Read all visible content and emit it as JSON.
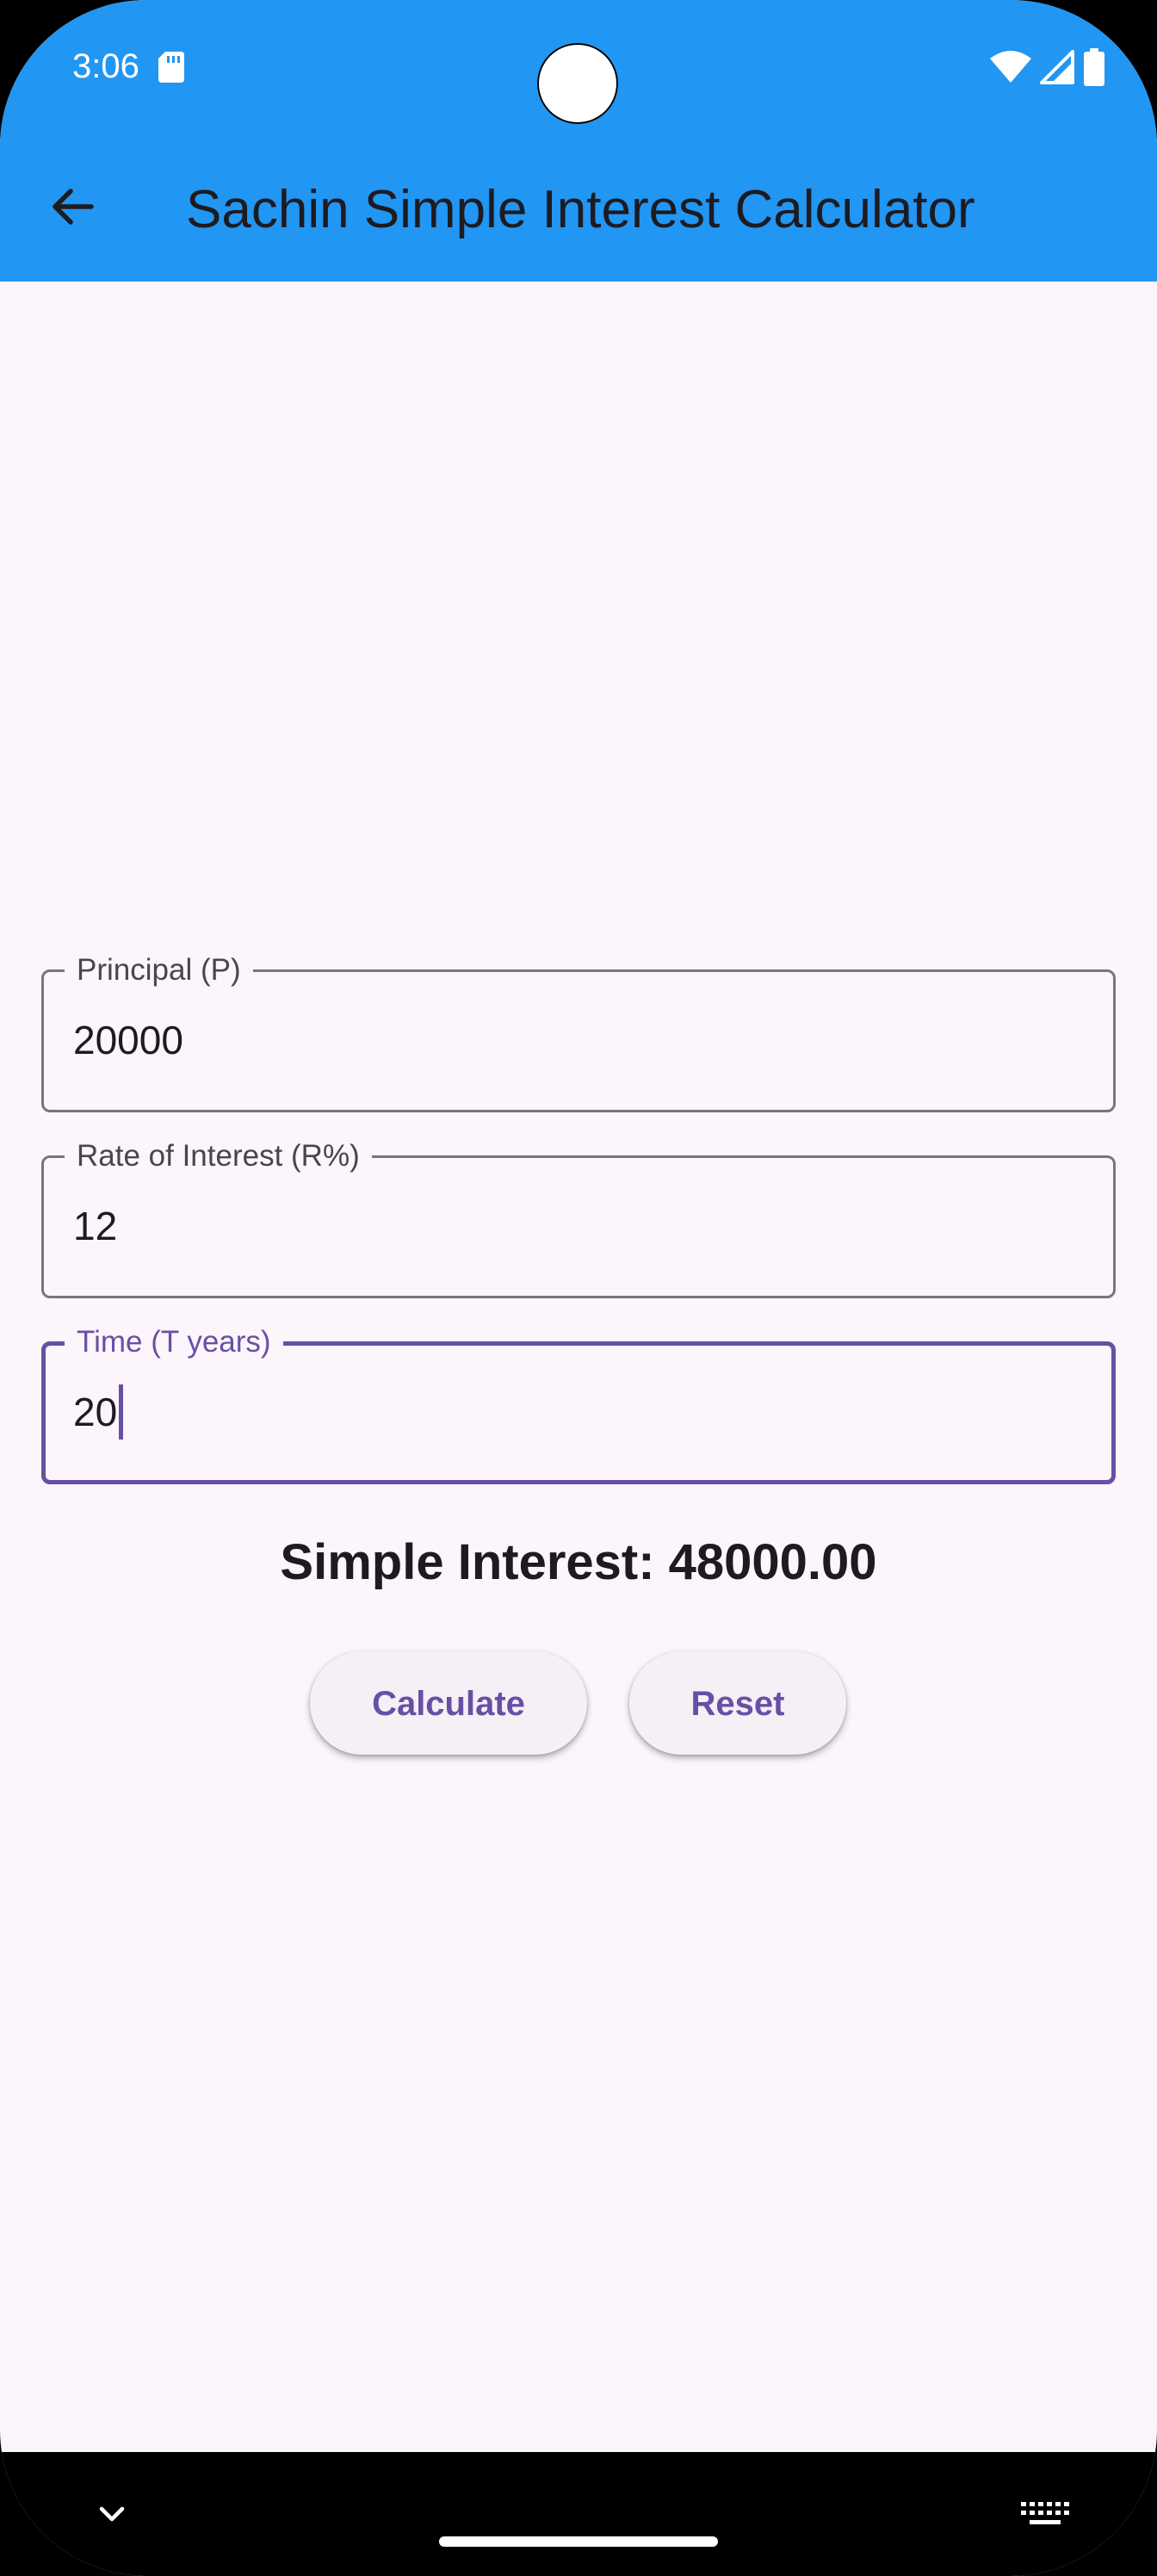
{
  "status_bar": {
    "time": "3:06"
  },
  "app_bar": {
    "title": "Sachin Simple Interest Calculator",
    "color": "#2196F3"
  },
  "fields": [
    {
      "label": "Principal (P)",
      "value": "20000",
      "focused": false
    },
    {
      "label": "Rate of Interest (R%)",
      "value": "12",
      "focused": false
    },
    {
      "label": "Time (T years)",
      "value": "20",
      "focused": true
    }
  ],
  "result": {
    "text": "Simple Interest: 48000.00"
  },
  "buttons": {
    "calculate_label": "Calculate",
    "reset_label": "Reset"
  },
  "colors": {
    "background": "#FCF5FB",
    "accent": "#6750A4",
    "outline": "#79747E"
  }
}
